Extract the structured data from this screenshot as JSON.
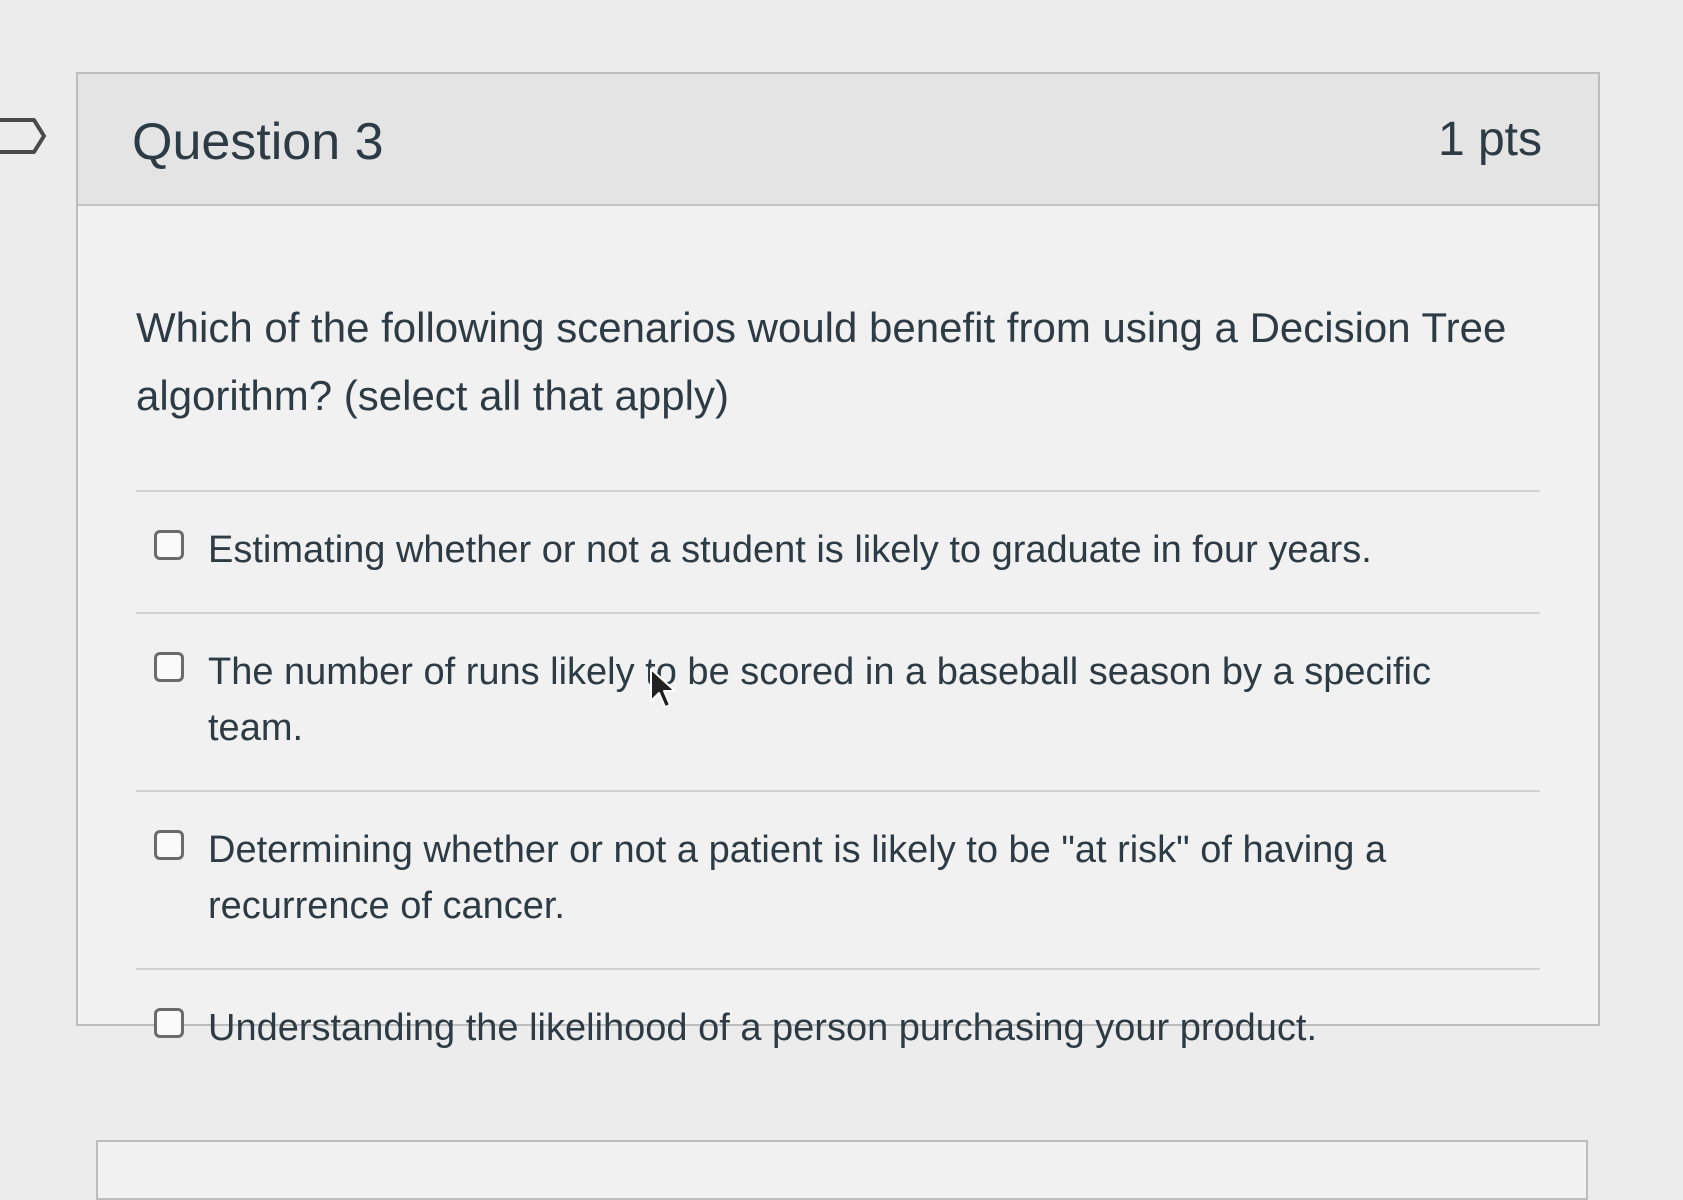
{
  "question": {
    "title": "Question 3",
    "points": "1 pts",
    "text": "Which of the following scenarios would benefit from using a Decision Tree algorithm?  (select all that apply)",
    "answers": [
      {
        "label": "Estimating whether or not a student is likely to graduate in four years.",
        "checked": false
      },
      {
        "label": "The number of runs likely to be scored in a baseball season by a specific team.",
        "checked": false
      },
      {
        "label": "Determining whether or not a patient is likely to be \"at risk\" of having a recurrence of cancer.",
        "checked": false
      },
      {
        "label": "Understanding the likelihood of a person purchasing your product.",
        "checked": false
      }
    ]
  },
  "icons": {
    "flag": "flag-icon",
    "cursor": "mouse-pointer-icon"
  }
}
